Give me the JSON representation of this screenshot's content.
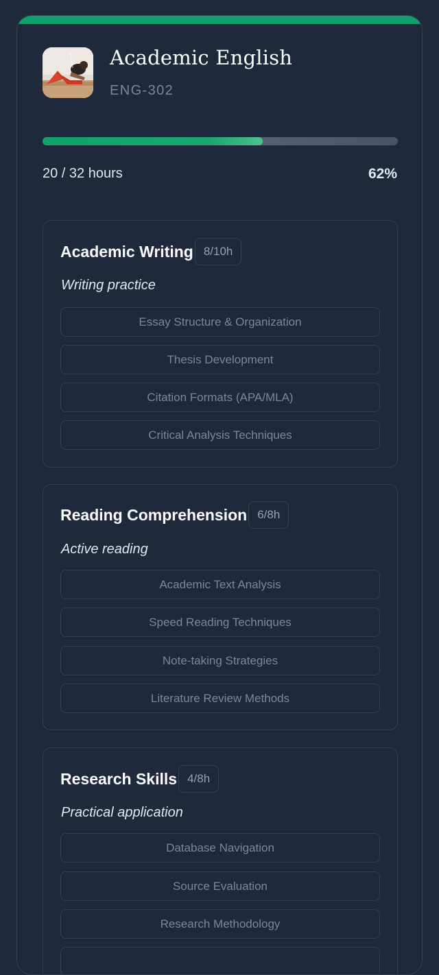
{
  "course": {
    "title": "Academic English",
    "code": "ENG-302",
    "hours_text": "20 / 32 hours",
    "percent_text": "62%",
    "progress": 0.62,
    "accent_color": "#11a06b",
    "thumbnail": "person-doing-sit-ups-photo"
  },
  "modules": [
    {
      "title": "Academic Writing",
      "hours": "8/10h",
      "subtitle": "Writing practice",
      "topics": [
        "Essay Structure & Organization",
        "Thesis Development",
        "Citation Formats (APA/MLA)",
        "Critical Analysis Techniques"
      ]
    },
    {
      "title": "Reading Comprehension",
      "hours": "6/8h",
      "subtitle": "Active reading",
      "topics": [
        "Academic Text Analysis",
        "Speed Reading Techniques",
        "Note-taking Strategies",
        "Literature Review Methods"
      ]
    },
    {
      "title": "Research Skills",
      "hours": "4/8h",
      "subtitle": "Practical application",
      "topics": [
        "Database Navigation",
        "Source Evaluation",
        "Research Methodology"
      ]
    }
  ]
}
